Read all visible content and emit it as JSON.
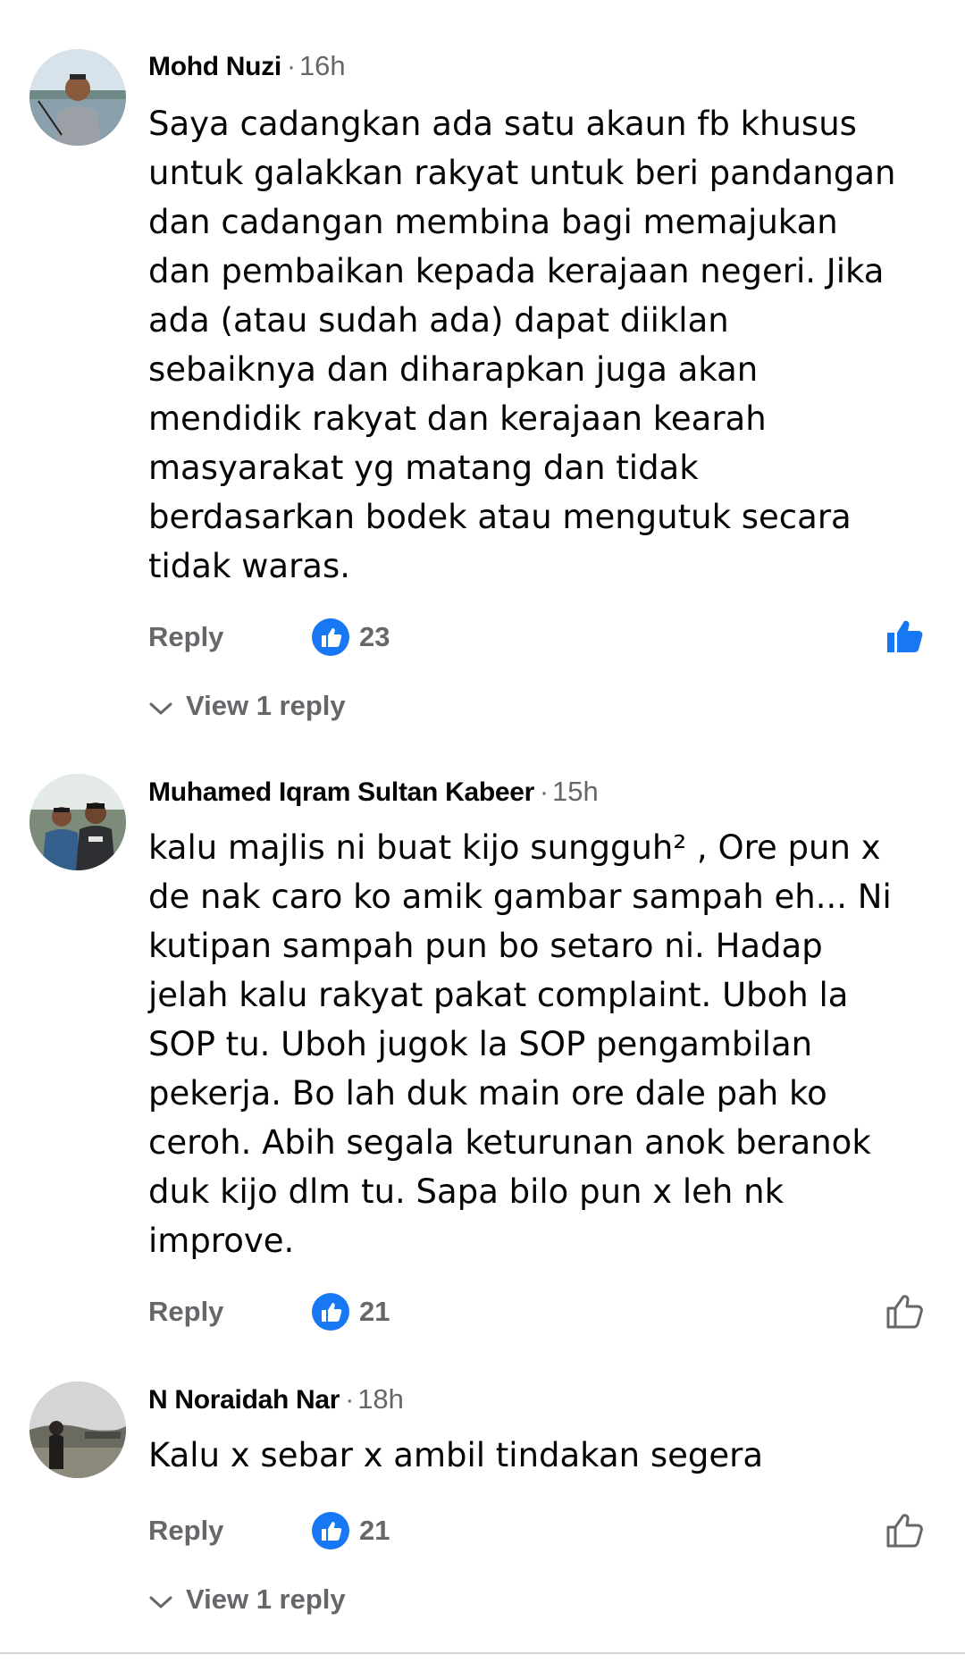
{
  "comments": [
    {
      "author": "Mohd Nuzi",
      "separator": "·",
      "time": "16h",
      "text": "Saya cadangkan ada satu akaun fb khusus\nuntuk galakkan rakyat untuk beri pandangan\ndan cadangan membina bagi memajukan\ndan pembaikan kepada kerajaan negeri. Jika\nada (atau sudah ada) dapat diiklan\nsebaiknya dan diharapkan juga akan\nmendidik rakyat dan kerajaan kearah\nmasyarakat yg matang dan tidak\nberdasarkan bodek atau mengutuk secara\ntidak waras.",
      "reply_label": "Reply",
      "reaction_count": "23",
      "liked": true,
      "view_replies_label": "View 1 reply"
    },
    {
      "author": "Muhamed Iqram Sultan Kabeer",
      "separator": "·",
      "time": "15h",
      "text": "kalu majlis ni buat kijo sungguh² , Ore pun x\nde nak caro ko amik gambar sampah eh... Ni\nkutipan sampah pun bo setaro ni. Hadap\njelah kalu rakyat pakat complaint. Uboh la\nSOP tu. Uboh jugok la SOP pengambilan\npekerja. Bo lah duk main ore dale pah ko\nceroh. Abih segala keturunan anok beranok\nduk kijo dlm tu. Sapa bilo pun x leh nk\nimprove.",
      "reply_label": "Reply",
      "reaction_count": "21",
      "liked": false
    },
    {
      "author": "N Noraidah Nar",
      "separator": "·",
      "time": "18h",
      "text": "Kalu x sebar x ambil tindakan segera",
      "reply_label": "Reply",
      "reaction_count": "21",
      "liked": false,
      "view_replies_label": "View 1 reply"
    }
  ],
  "colors": {
    "like_blue": "#1877f2",
    "meta_gray": "#65676b",
    "text": "#050505"
  },
  "icons": {
    "reaction": "like-reaction-icon",
    "like_filled": "thumbs-up-filled-icon",
    "like_outline": "thumbs-up-outline-icon",
    "chevron": "chevron-down-icon"
  }
}
